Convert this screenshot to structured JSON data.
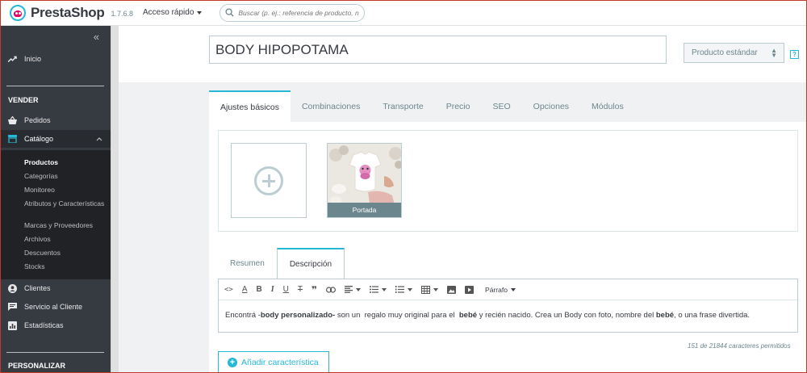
{
  "header": {
    "logo_text": "PrestaShop",
    "version": "1.7.6.8",
    "quick_access": "Acceso rápido",
    "search_placeholder": "Buscar (p. ej.: referencia de producto, no"
  },
  "sidebar": {
    "collapse_glyph": "«",
    "home": "Inicio",
    "section_sell": "VENDER",
    "orders": "Pedidos",
    "catalog": "Catálogo",
    "submenu": [
      "Productos",
      "Categorías",
      "Monitoreo",
      "Atributos y Características",
      "Marcas y Proveedores",
      "Archivos",
      "Descuentos",
      "Stocks"
    ],
    "customers": "Clientes",
    "customer_service": "Servicio al Cliente",
    "stats": "Estadísticas",
    "section_customize": "PERSONALIZAR"
  },
  "product": {
    "name": "BODY HIPOPOTAMA",
    "type": "Producto estándar",
    "help": "?"
  },
  "tabs": [
    "Ajustes básicos",
    "Combinaciones",
    "Transporte",
    "Precio",
    "SEO",
    "Opciones",
    "Módulos"
  ],
  "images": {
    "cover_label": "Portada"
  },
  "description": {
    "tab_summary": "Resumen",
    "tab_description": "Descripción",
    "paragraph_format": "Párrafo",
    "text_1": "Encontrá -",
    "text_bold_1": "body personalizado-",
    "text_2": " son un  regalo muy original para el  ",
    "text_bold_2": "bebé",
    "text_3": " y recién nacido. Crea un Body con foto, nombre del ",
    "text_bold_3": "bebé",
    "text_4": ", o una frase divertida.",
    "char_count": "151 de 21844 caracteres permitidos"
  },
  "add_feature": "Añadir característica",
  "colors": {
    "accent": "#25b9d7",
    "sidebar": "#363a41",
    "brand_pink": "#df0067"
  }
}
